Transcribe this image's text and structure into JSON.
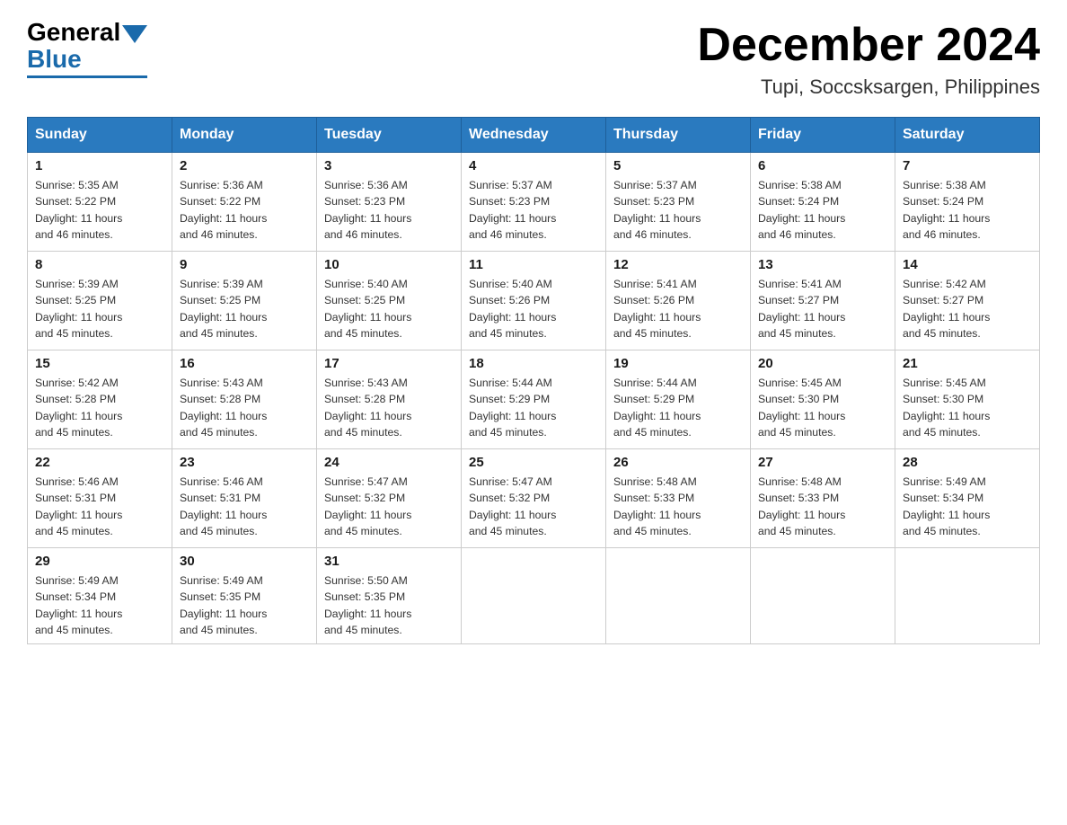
{
  "header": {
    "logo": {
      "text_general": "General",
      "text_blue": "Blue"
    },
    "title": "December 2024",
    "location": "Tupi, Soccsksargen, Philippines"
  },
  "calendar": {
    "days_of_week": [
      "Sunday",
      "Monday",
      "Tuesday",
      "Wednesday",
      "Thursday",
      "Friday",
      "Saturday"
    ],
    "weeks": [
      [
        {
          "day": "1",
          "sunrise": "5:35 AM",
          "sunset": "5:22 PM",
          "daylight": "11 hours and 46 minutes."
        },
        {
          "day": "2",
          "sunrise": "5:36 AM",
          "sunset": "5:22 PM",
          "daylight": "11 hours and 46 minutes."
        },
        {
          "day": "3",
          "sunrise": "5:36 AM",
          "sunset": "5:23 PM",
          "daylight": "11 hours and 46 minutes."
        },
        {
          "day": "4",
          "sunrise": "5:37 AM",
          "sunset": "5:23 PM",
          "daylight": "11 hours and 46 minutes."
        },
        {
          "day": "5",
          "sunrise": "5:37 AM",
          "sunset": "5:23 PM",
          "daylight": "11 hours and 46 minutes."
        },
        {
          "day": "6",
          "sunrise": "5:38 AM",
          "sunset": "5:24 PM",
          "daylight": "11 hours and 46 minutes."
        },
        {
          "day": "7",
          "sunrise": "5:38 AM",
          "sunset": "5:24 PM",
          "daylight": "11 hours and 46 minutes."
        }
      ],
      [
        {
          "day": "8",
          "sunrise": "5:39 AM",
          "sunset": "5:25 PM",
          "daylight": "11 hours and 45 minutes."
        },
        {
          "day": "9",
          "sunrise": "5:39 AM",
          "sunset": "5:25 PM",
          "daylight": "11 hours and 45 minutes."
        },
        {
          "day": "10",
          "sunrise": "5:40 AM",
          "sunset": "5:25 PM",
          "daylight": "11 hours and 45 minutes."
        },
        {
          "day": "11",
          "sunrise": "5:40 AM",
          "sunset": "5:26 PM",
          "daylight": "11 hours and 45 minutes."
        },
        {
          "day": "12",
          "sunrise": "5:41 AM",
          "sunset": "5:26 PM",
          "daylight": "11 hours and 45 minutes."
        },
        {
          "day": "13",
          "sunrise": "5:41 AM",
          "sunset": "5:27 PM",
          "daylight": "11 hours and 45 minutes."
        },
        {
          "day": "14",
          "sunrise": "5:42 AM",
          "sunset": "5:27 PM",
          "daylight": "11 hours and 45 minutes."
        }
      ],
      [
        {
          "day": "15",
          "sunrise": "5:42 AM",
          "sunset": "5:28 PM",
          "daylight": "11 hours and 45 minutes."
        },
        {
          "day": "16",
          "sunrise": "5:43 AM",
          "sunset": "5:28 PM",
          "daylight": "11 hours and 45 minutes."
        },
        {
          "day": "17",
          "sunrise": "5:43 AM",
          "sunset": "5:28 PM",
          "daylight": "11 hours and 45 minutes."
        },
        {
          "day": "18",
          "sunrise": "5:44 AM",
          "sunset": "5:29 PM",
          "daylight": "11 hours and 45 minutes."
        },
        {
          "day": "19",
          "sunrise": "5:44 AM",
          "sunset": "5:29 PM",
          "daylight": "11 hours and 45 minutes."
        },
        {
          "day": "20",
          "sunrise": "5:45 AM",
          "sunset": "5:30 PM",
          "daylight": "11 hours and 45 minutes."
        },
        {
          "day": "21",
          "sunrise": "5:45 AM",
          "sunset": "5:30 PM",
          "daylight": "11 hours and 45 minutes."
        }
      ],
      [
        {
          "day": "22",
          "sunrise": "5:46 AM",
          "sunset": "5:31 PM",
          "daylight": "11 hours and 45 minutes."
        },
        {
          "day": "23",
          "sunrise": "5:46 AM",
          "sunset": "5:31 PM",
          "daylight": "11 hours and 45 minutes."
        },
        {
          "day": "24",
          "sunrise": "5:47 AM",
          "sunset": "5:32 PM",
          "daylight": "11 hours and 45 minutes."
        },
        {
          "day": "25",
          "sunrise": "5:47 AM",
          "sunset": "5:32 PM",
          "daylight": "11 hours and 45 minutes."
        },
        {
          "day": "26",
          "sunrise": "5:48 AM",
          "sunset": "5:33 PM",
          "daylight": "11 hours and 45 minutes."
        },
        {
          "day": "27",
          "sunrise": "5:48 AM",
          "sunset": "5:33 PM",
          "daylight": "11 hours and 45 minutes."
        },
        {
          "day": "28",
          "sunrise": "5:49 AM",
          "sunset": "5:34 PM",
          "daylight": "11 hours and 45 minutes."
        }
      ],
      [
        {
          "day": "29",
          "sunrise": "5:49 AM",
          "sunset": "5:34 PM",
          "daylight": "11 hours and 45 minutes."
        },
        {
          "day": "30",
          "sunrise": "5:49 AM",
          "sunset": "5:35 PM",
          "daylight": "11 hours and 45 minutes."
        },
        {
          "day": "31",
          "sunrise": "5:50 AM",
          "sunset": "5:35 PM",
          "daylight": "11 hours and 45 minutes."
        },
        null,
        null,
        null,
        null
      ]
    ],
    "labels": {
      "sunrise": "Sunrise:",
      "sunset": "Sunset:",
      "daylight": "Daylight:"
    }
  }
}
